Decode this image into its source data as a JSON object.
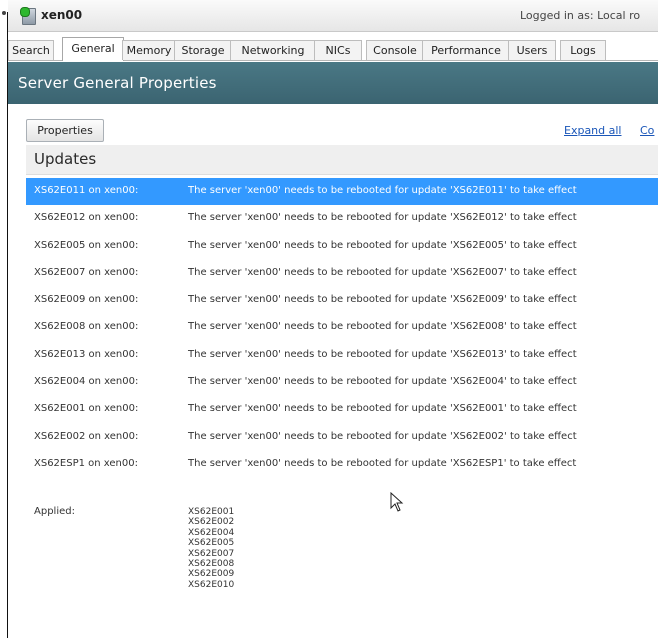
{
  "window": {
    "title": "xen00",
    "login_status": "Logged in as: Local ro"
  },
  "tabs": [
    {
      "label": "Search",
      "active": false
    },
    {
      "label": "General",
      "active": true
    },
    {
      "label": "Memory",
      "active": false
    },
    {
      "label": "Storage",
      "active": false
    },
    {
      "label": "Networking",
      "active": false
    },
    {
      "label": "NICs",
      "active": false
    },
    {
      "label": "Console",
      "active": false
    },
    {
      "label": "Performance",
      "active": false
    },
    {
      "label": "Users",
      "active": false
    },
    {
      "label": "Logs",
      "active": false
    }
  ],
  "section": {
    "title": "Server General Properties"
  },
  "toolbar": {
    "properties_label": "Properties",
    "expand_all_label": "Expand all",
    "collapse_label": "Co"
  },
  "updates": {
    "header": "Updates",
    "rows": [
      {
        "name": "XS62E011 on xen00:",
        "message": "The server 'xen00' needs to be rebooted for update 'XS62E011' to take effect",
        "selected": true
      },
      {
        "name": "XS62E012 on xen00:",
        "message": "The server 'xen00' needs to be rebooted for update 'XS62E012' to take effect",
        "selected": false
      },
      {
        "name": "XS62E005 on xen00:",
        "message": "The server 'xen00' needs to be rebooted for update 'XS62E005' to take effect",
        "selected": false
      },
      {
        "name": "XS62E007 on xen00:",
        "message": "The server 'xen00' needs to be rebooted for update 'XS62E007' to take effect",
        "selected": false
      },
      {
        "name": "XS62E009 on xen00:",
        "message": "The server 'xen00' needs to be rebooted for update 'XS62E009' to take effect",
        "selected": false
      },
      {
        "name": "XS62E008 on xen00:",
        "message": "The server 'xen00' needs to be rebooted for update 'XS62E008' to take effect",
        "selected": false
      },
      {
        "name": "XS62E013 on xen00:",
        "message": "The server 'xen00' needs to be rebooted for update 'XS62E013' to take effect",
        "selected": false
      },
      {
        "name": "XS62E004 on xen00:",
        "message": "The server 'xen00' needs to be rebooted for update 'XS62E004' to take effect",
        "selected": false
      },
      {
        "name": "XS62E001 on xen00:",
        "message": "The server 'xen00' needs to be rebooted for update 'XS62E001' to take effect",
        "selected": false
      },
      {
        "name": "XS62E002 on xen00:",
        "message": "The server 'xen00' needs to be rebooted for update 'XS62E002' to take effect",
        "selected": false
      },
      {
        "name": "XS62ESP1 on xen00:",
        "message": "The server 'xen00' needs to be rebooted for update 'XS62ESP1' to take effect",
        "selected": false
      }
    ],
    "applied_label": "Applied:",
    "applied": [
      "XS62E001",
      "XS62E002",
      "XS62E004",
      "XS62E005",
      "XS62E007",
      "XS62E008",
      "XS62E009",
      "XS62E010"
    ]
  },
  "colors": {
    "selected_row": "#3399ff",
    "section_header": "#3f6b78",
    "link": "#1a56b8",
    "status_led": "#2eb82e"
  },
  "icons": {
    "server": "server-icon",
    "status": "status-led-icon",
    "cursor": "mouse-cursor-icon"
  }
}
